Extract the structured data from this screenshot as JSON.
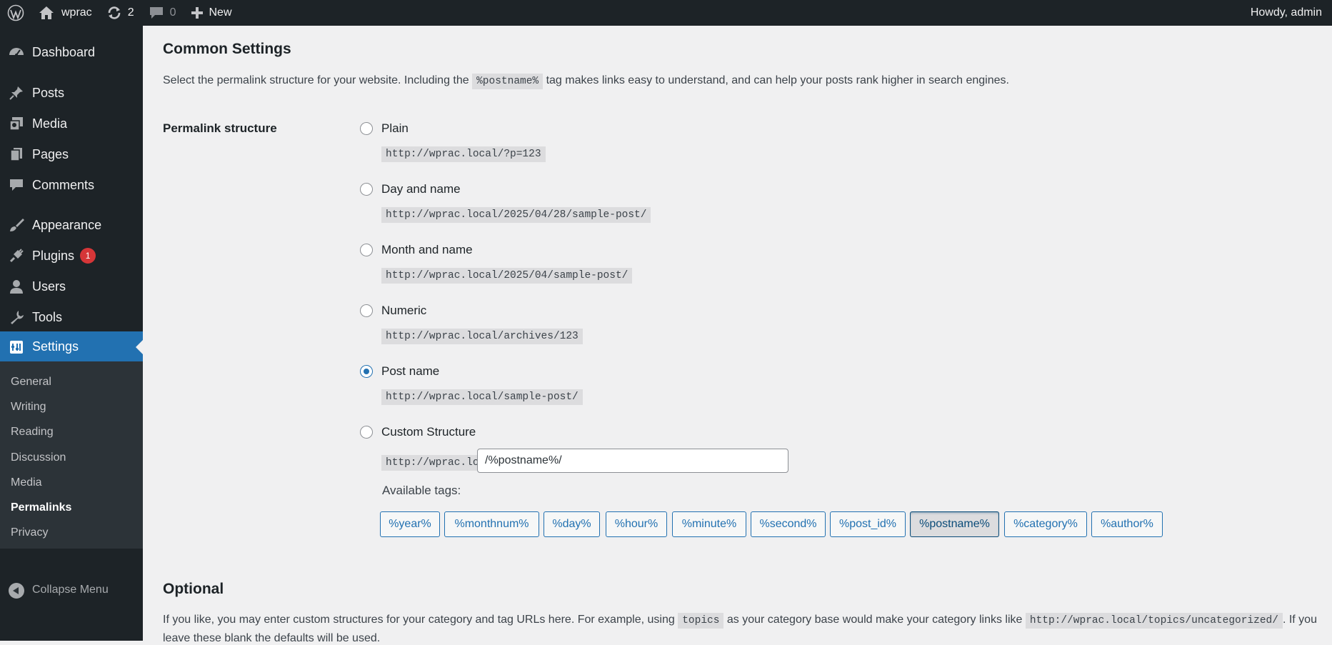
{
  "adminbar": {
    "site_name": "wprac",
    "updates_count": "2",
    "comments_count": "0",
    "new_label": "New",
    "howdy": "Howdy, admin"
  },
  "sidebar": {
    "items": [
      {
        "label": "Dashboard",
        "icon": "dashboard-icon"
      },
      {
        "label": "Posts",
        "icon": "pin-icon"
      },
      {
        "label": "Media",
        "icon": "media-icon"
      },
      {
        "label": "Pages",
        "icon": "pages-icon"
      },
      {
        "label": "Comments",
        "icon": "comment-icon"
      },
      {
        "label": "Appearance",
        "icon": "brush-icon"
      },
      {
        "label": "Plugins",
        "icon": "plug-icon",
        "badge": "1"
      },
      {
        "label": "Users",
        "icon": "user-icon"
      },
      {
        "label": "Tools",
        "icon": "wrench-icon"
      },
      {
        "label": "Settings",
        "icon": "settings-icon"
      }
    ],
    "submenu": [
      "General",
      "Writing",
      "Reading",
      "Discussion",
      "Media",
      "Permalinks",
      "Privacy"
    ],
    "collapse_label": "Collapse Menu"
  },
  "main": {
    "common_title": "Common Settings",
    "common_desc_before": "Select the permalink structure for your website. Including the",
    "common_desc_tag": "%postname%",
    "common_desc_after": "tag makes links easy to understand, and can help your posts rank higher in search engines.",
    "structure_label": "Permalink structure",
    "options": [
      {
        "label": "Plain",
        "example": "http://wprac.local/?p=123"
      },
      {
        "label": "Day and name",
        "example": "http://wprac.local/2025/04/28/sample-post/"
      },
      {
        "label": "Month and name",
        "example": "http://wprac.local/2025/04/sample-post/"
      },
      {
        "label": "Numeric",
        "example": "http://wprac.local/archives/123"
      },
      {
        "label": "Post name",
        "example": "http://wprac.local/sample-post/"
      },
      {
        "label": "Custom Structure",
        "example": "http://wprac.local"
      }
    ],
    "selected_option": "Post name",
    "custom_value": "/%postname%/",
    "available_tags_label": "Available tags:",
    "tags": [
      "%year%",
      "%monthnum%",
      "%day%",
      "%hour%",
      "%minute%",
      "%second%",
      "%post_id%",
      "%postname%",
      "%category%",
      "%author%"
    ],
    "active_tag": "%postname%",
    "optional_title": "Optional",
    "optional_desc_before": "If you like, you may enter custom structures for your category and tag URLs here. For example, using",
    "optional_desc_code1": "topics",
    "optional_desc_mid": "as your category base would make your category links like",
    "optional_desc_code2": "http://wprac.local/topics/uncategorized/",
    "optional_desc_after": ". If you",
    "optional_desc_line2": "leave these blank the defaults will be used."
  },
  "colors": {
    "admin_bar": "#1d2327",
    "accent": "#2271b1",
    "badge": "#d63638"
  }
}
